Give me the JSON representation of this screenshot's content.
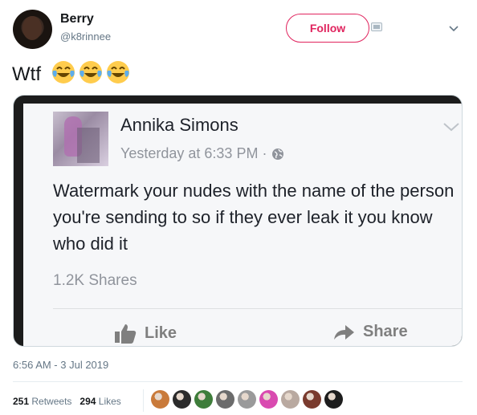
{
  "author": {
    "name": "Berry",
    "handle": "@k8rinnee"
  },
  "header": {
    "follow_label": "Follow"
  },
  "tweet": {
    "text": "Wtf",
    "emoji_icons": [
      "face-with-tears-of-joy-icon",
      "face-with-tears-of-joy-icon",
      "face-with-tears-of-joy-icon"
    ]
  },
  "embedded_post": {
    "name": "Annika Simons",
    "time": "Yesterday at 6:33 PM ·",
    "text": "Watermark your nudes with the name of the person you're sending to so if they ever leak it you know who did it",
    "shares": "1.2K Shares",
    "like_label": "Like",
    "share_label": "Share"
  },
  "meta": {
    "timestamp": "6:56 AM - 3 Jul 2019"
  },
  "stats": {
    "retweets_count": "251",
    "retweets_label": "Retweets",
    "likes_count": "294",
    "likes_label": "Likes"
  },
  "likers": [
    "#c97a3a",
    "#2b2b2b",
    "#3e7d3a",
    "#6b6b6b",
    "#9a9a9a",
    "#d94ab0",
    "#b9a9a0",
    "#7a3b2e",
    "#1d1d1d"
  ],
  "colors": {
    "follow": "#e0245e",
    "text": "#14171a",
    "secondary": "#657786"
  }
}
